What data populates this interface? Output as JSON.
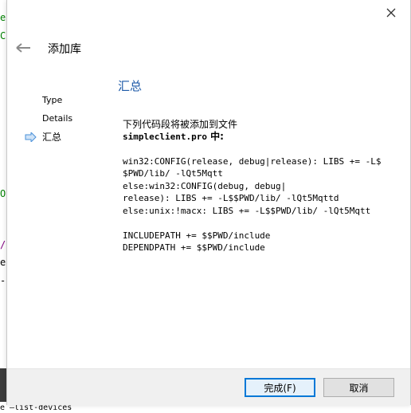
{
  "dialog": {
    "title": "添加库",
    "steps": [
      "Type",
      "Details",
      "汇总"
    ],
    "page_title": "汇总",
    "intro_line1": "下列代码段将被添加到文件",
    "file_name": "simpleclient.pro",
    "file_suffix": " 中:",
    "code_lines": [
      "win32:CONFIG(release, debug|release): LIBS += -L$",
      "$PWD/lib/ -lQt5Mqtt",
      "else:win32:CONFIG(debug, debug|",
      "release): LIBS += -L$$PWD/lib/ -lQt5Mqttd",
      "else:unix:!macx: LIBS += -L$$PWD/lib/ -lQt5Mqtt",
      "",
      "INCLUDEPATH += $$PWD/include",
      "DEPENDPATH += $$PWD/include"
    ],
    "finish_label": "完成(F)",
    "cancel_label": "取消"
  },
  "background": {
    "terminal_text": "e —list-devices",
    "colors": {
      "green": "#008000",
      "purple": "#800080"
    }
  },
  "colors": {
    "accent": "#0078d7",
    "page_title": "#1e5aa8",
    "step_arrow": "#4a90d9"
  }
}
